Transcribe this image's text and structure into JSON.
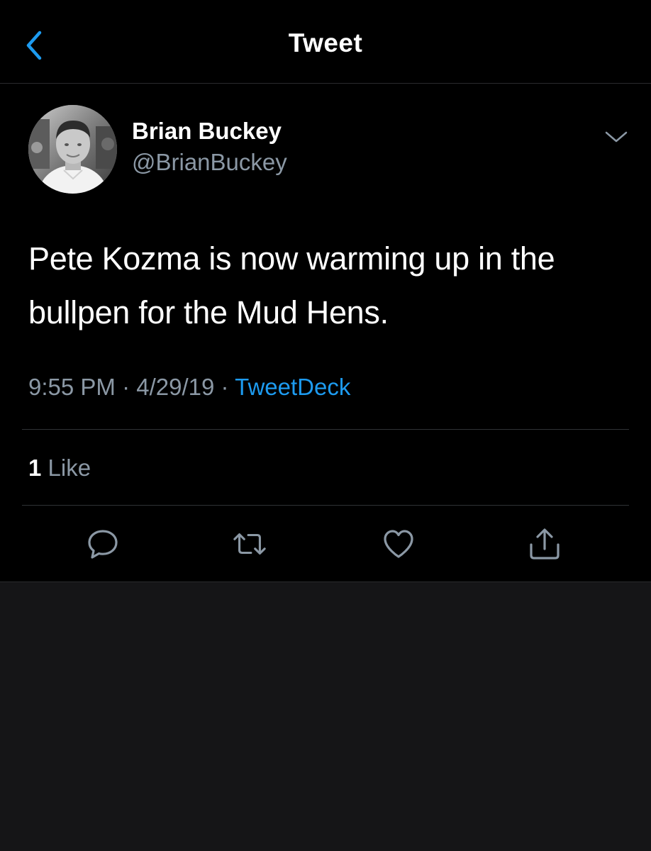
{
  "nav": {
    "title": "Tweet",
    "back_icon": "chevron-left-icon"
  },
  "tweet": {
    "author": {
      "display_name": "Brian Buckey",
      "handle": "@BrianBuckey"
    },
    "text": "Pete Kozma is now warming up in the bullpen for the Mud Hens.",
    "time": "9:55 PM",
    "date": "4/29/19",
    "separator": "·",
    "source": "TweetDeck",
    "likes": {
      "count": "1",
      "label": "Like"
    }
  },
  "actions": [
    {
      "name": "reply",
      "icon": "speech-bubble-icon"
    },
    {
      "name": "retweet",
      "icon": "retweet-icon"
    },
    {
      "name": "like",
      "icon": "heart-icon"
    },
    {
      "name": "share",
      "icon": "share-icon"
    }
  ],
  "colors": {
    "background": "#000000",
    "below_panel": "#151517",
    "accent": "#1d9bf0",
    "secondary_text": "#8b98a5",
    "icon": "#8b98a5",
    "divider": "#2f3336"
  }
}
